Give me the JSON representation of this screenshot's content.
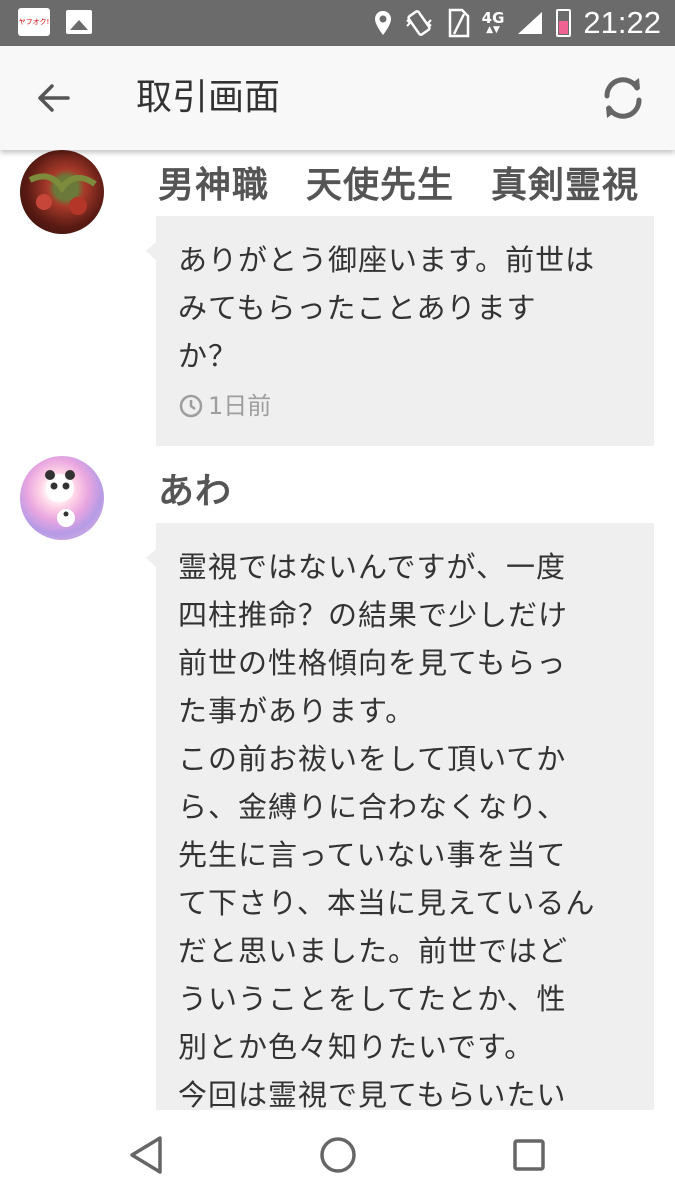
{
  "status_bar": {
    "app_badge_text": "ヤフオク!",
    "network": "4G",
    "time": "21:22",
    "battery_color": "#f06292"
  },
  "app_bar": {
    "title": "取引画面",
    "back_icon": "arrow-left-icon",
    "refresh_icon": "refresh-icon"
  },
  "messages": [
    {
      "sender": "男神職　天使先生　真剣霊視",
      "avatar": "avatar-flowers",
      "text": "ありがとう御座います。前世は\nみてもらったことあります\nか？",
      "time": "1日前"
    },
    {
      "sender": "あわ",
      "avatar": "avatar-panda",
      "text": "霊視ではないんですが、一度\n四柱推命？の結果で少しだけ\n前世の性格傾向を見てもらっ\nた事があります。\nこの前お祓いをして頂いてか\nら、金縛りに合わなくなり、\n先生に言っていない事を当て\nて下さり、本当に見えているん\nだと思いました。前世ではど\nういうことをしてたとか、性\n別とか色々知りたいです。\n今回は霊視で見てもらいたい"
    }
  ],
  "nav_bar": {
    "back_icon": "triangle-back-icon",
    "home_icon": "circle-home-icon",
    "recents_icon": "square-recents-icon"
  }
}
